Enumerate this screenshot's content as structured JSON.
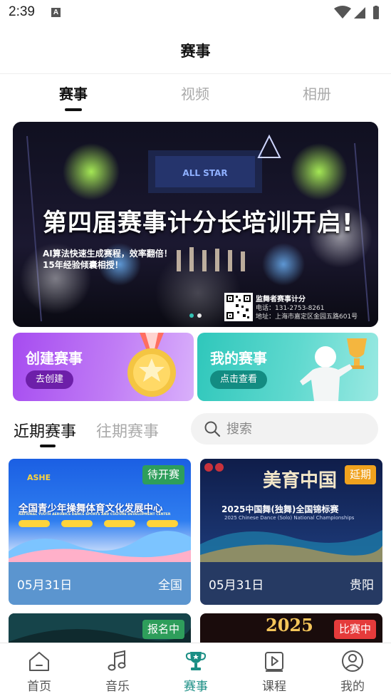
{
  "status_bar": {
    "time": "2:39",
    "notification_letter": "A"
  },
  "header": {
    "title": "赛事"
  },
  "top_tabs": [
    {
      "label": "赛事",
      "active": true
    },
    {
      "label": "视频",
      "active": false
    },
    {
      "label": "相册",
      "active": false
    }
  ],
  "banner": {
    "title": "第四届赛事计分长培训开启!",
    "subtitle_line1": "AI算法快速生成赛程，效率翻倍！",
    "subtitle_line2": "15年经验倾囊相授！",
    "contact_name": "监舞者赛事计分",
    "contact_phone": "电话：131-2753-8261",
    "contact_address": "地址：上海市嘉定区金园五路601号",
    "stage_text": "ALL STAR",
    "carousel_index": 1,
    "carousel_count": 2
  },
  "actions": {
    "create": {
      "label": "创建赛事",
      "button": "去创建",
      "icon": "gold-medal-icon"
    },
    "mine": {
      "label": "我的赛事",
      "button": "点击查看",
      "icon": "trophy-figure-icon"
    }
  },
  "sub_tabs": [
    {
      "label": "近期赛事",
      "active": true
    },
    {
      "label": "往期赛事",
      "active": false
    }
  ],
  "search": {
    "placeholder": "搜索"
  },
  "events": [
    {
      "badge": "待开赛",
      "badge_color": "#2e9e5b",
      "date": "05月31日",
      "region": "全国",
      "poster_title": "全国青少年操舞体育文化发展中心",
      "poster_subtitle": "NATIONAL YOUTH AEROBICS DANCE SPORTS AND CULTURE DEVELOPMENT CENTER",
      "poster_logo": "ASHE"
    },
    {
      "badge": "延期",
      "badge_color": "#f0a21e",
      "date": "05月31日",
      "region": "贵阳",
      "poster_title": "2025中国舞(独舞)全国锦标赛",
      "poster_subtitle": "2025 Chinese Dance (Solo) National Championships",
      "poster_logo": "美育中国"
    },
    {
      "badge": "报名中",
      "badge_color": "#2e9e5b"
    },
    {
      "badge": "比赛中",
      "badge_color": "#e53b3b",
      "poster_title": "2025"
    }
  ],
  "bottom_nav": [
    {
      "label": "首页",
      "icon": "home-icon",
      "active": false
    },
    {
      "label": "音乐",
      "icon": "music-note-icon",
      "active": false
    },
    {
      "label": "赛事",
      "icon": "trophy-icon",
      "active": true
    },
    {
      "label": "课程",
      "icon": "play-book-icon",
      "active": false
    },
    {
      "label": "我的",
      "icon": "user-icon",
      "active": false
    }
  ],
  "colors": {
    "accent": "#1a8e84",
    "create_card": "#a64cf0",
    "mine_card": "#2fc7bb"
  }
}
